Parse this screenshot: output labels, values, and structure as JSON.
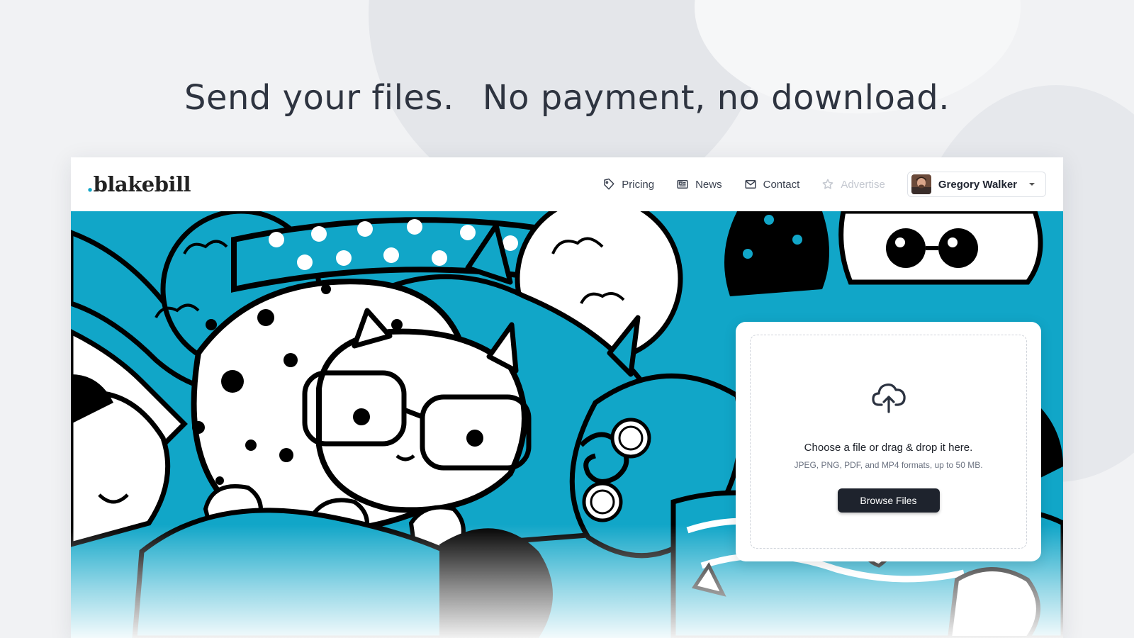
{
  "headline": {
    "part1": "Send your files.",
    "part2": "No payment, no download."
  },
  "logo": {
    "dot": ".",
    "name": "blakebill"
  },
  "nav": {
    "items": [
      {
        "label": "Pricing",
        "icon": "tag-icon",
        "enabled": true
      },
      {
        "label": "News",
        "icon": "newspaper-icon",
        "enabled": true
      },
      {
        "label": "Contact",
        "icon": "mail-icon",
        "enabled": true
      },
      {
        "label": "Advertise",
        "icon": "star-icon",
        "enabled": false
      }
    ]
  },
  "user": {
    "name": "Gregory Walker",
    "icon": "chevron-down-icon"
  },
  "upload": {
    "icon": "cloud-upload-icon",
    "title": "Choose a file or drag & drop it here.",
    "subtitle": "JPEG, PNG, PDF, and MP4 formats, up to 50 MB.",
    "button_label": "Browse Files"
  },
  "colors": {
    "accent": "#11a6c8",
    "button": "#1e232d",
    "page_bg": "#f1f2f4"
  }
}
